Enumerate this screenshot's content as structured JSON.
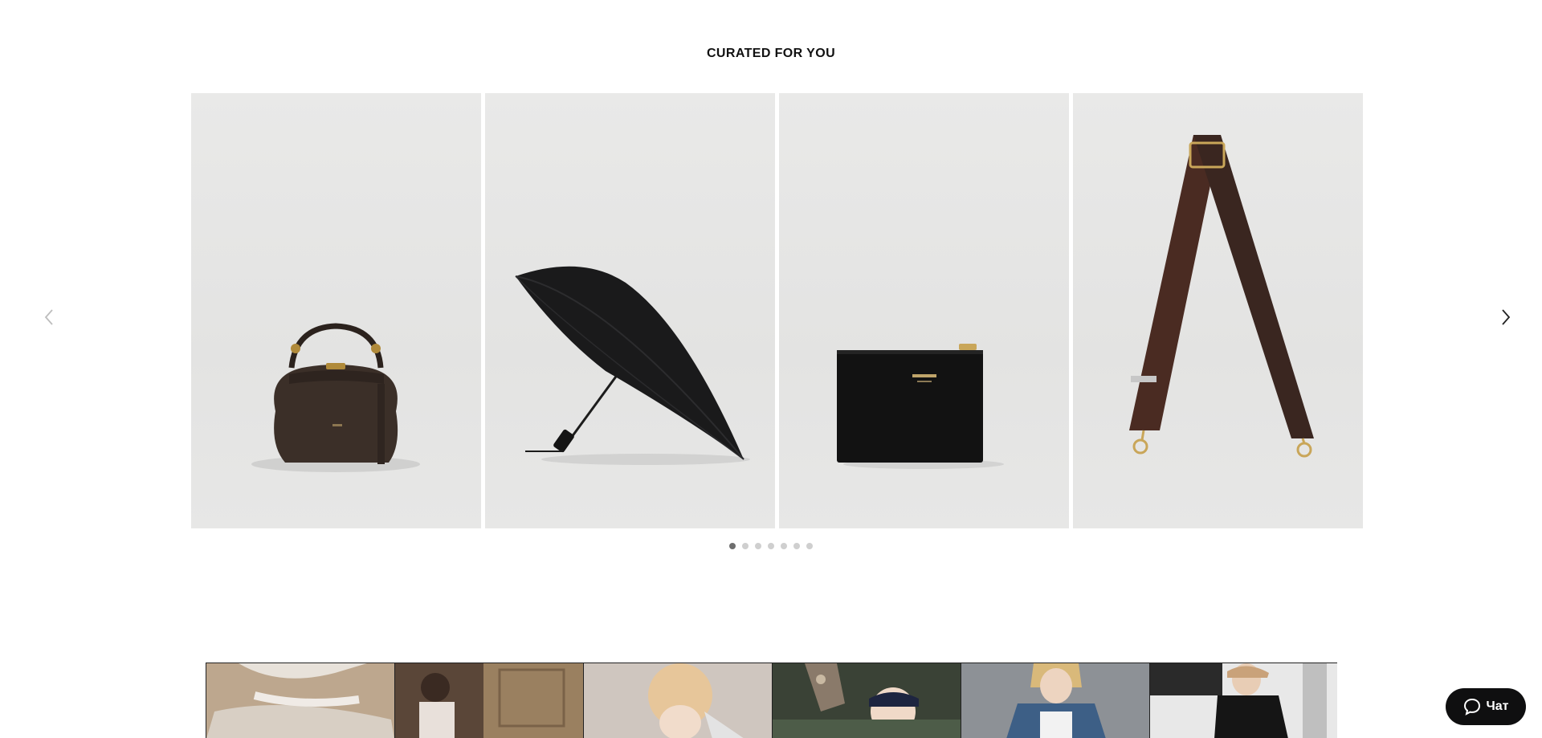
{
  "section": {
    "title": "CURATED FOR YOU"
  },
  "carousel": {
    "items": [
      {
        "name": "Leather handbag"
      },
      {
        "name": "Folding umbrella"
      },
      {
        "name": "Zip card pouch"
      },
      {
        "name": "Bag strap"
      }
    ],
    "prev_icon": "chevron-left-icon",
    "next_icon": "chevron-right-icon",
    "pagination": {
      "total": 7,
      "active": 1
    }
  },
  "chat": {
    "label": "Чат",
    "icon": "chat-bubble-icon"
  },
  "colors": {
    "background": "#ffffff",
    "card_background": "#e6e6e5",
    "chat_button": "#0f0f10",
    "dot_active": "#6e6e6e",
    "dot_inactive": "#cfcfcf"
  }
}
